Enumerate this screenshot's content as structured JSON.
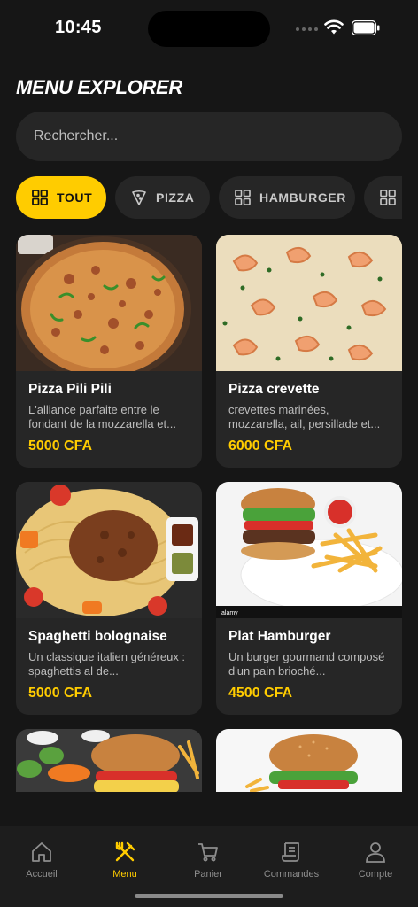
{
  "status": {
    "time": "10:45"
  },
  "header": {
    "title": "MENU EXPLORER"
  },
  "search": {
    "placeholder": "Rechercher..."
  },
  "categories": [
    {
      "label": "TOUT",
      "icon": "grid-icon",
      "active": true
    },
    {
      "label": "PIZZA",
      "icon": "pizza-slice-icon",
      "active": false
    },
    {
      "label": "HAMBURGER",
      "icon": "grid-icon",
      "active": false
    },
    {
      "label": "",
      "icon": "grid-icon",
      "active": false
    }
  ],
  "items": [
    {
      "name": "Pizza Pili Pili",
      "desc": "L'alliance parfaite entre le fondant de la mozzarella et...",
      "price": "5000 CFA"
    },
    {
      "name": "Pizza crevette",
      "desc": "crevettes marinées, mozzarella, ail, persillade et...",
      "price": "6000 CFA"
    },
    {
      "name": "Spaghetti bolognaise",
      "desc": "Un classique italien généreux : spaghettis al de...",
      "price": "5000 CFA"
    },
    {
      "name": "Plat Hamburger",
      "desc": "Un burger gourmand composé d'un pain brioché...",
      "price": "4500 CFA"
    },
    {
      "name": "",
      "desc": "",
      "price": ""
    },
    {
      "name": "",
      "desc": "",
      "price": ""
    }
  ],
  "tabbar": [
    {
      "label": "Accueil",
      "icon": "home-icon",
      "active": false
    },
    {
      "label": "Menu",
      "icon": "fork-knife-icon",
      "active": true
    },
    {
      "label": "Panier",
      "icon": "cart-icon",
      "active": false
    },
    {
      "label": "Commandes",
      "icon": "receipt-icon",
      "active": false
    },
    {
      "label": "Compte",
      "icon": "user-icon",
      "active": false
    }
  ],
  "colors": {
    "accent": "#FFCC00",
    "background": "#161616",
    "card": "#262626"
  }
}
